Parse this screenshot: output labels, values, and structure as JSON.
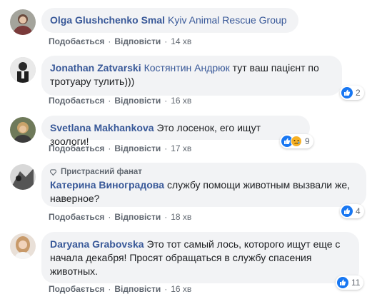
{
  "action_labels": {
    "like": "Подобається",
    "reply": "Відповісти",
    "separator": "·"
  },
  "comments": [
    {
      "author": "Olga Glushchenko Smal",
      "mention": "Kyiv Animal Rescue Group",
      "text": "",
      "time": "14 хв"
    },
    {
      "author": "Jonathan Zatvarski",
      "mention": "Костянтин Андрюк",
      "text": "тут ваш пацієнт по тротуару тулить)))",
      "time": "16 хв",
      "reaction_count": "2"
    },
    {
      "author": "Svetlana Makhankova",
      "mention": "",
      "text": "Это лосенок, его ищут зоологи!",
      "time": "17 хв",
      "reaction_count": "9"
    },
    {
      "badge": "Пристрасний фанат",
      "author": "Катерина Виноградова",
      "mention": "",
      "text": "службу помощи животным вызвали же, наверное?",
      "time": "18 хв",
      "reaction_count": "4"
    },
    {
      "author": "Daryana Grabovska",
      "mention": "",
      "text": "Это тот самый лось, которого ищут еще с начала декабря! Просят обращаться в службу спасения животных.",
      "time": "16 хв",
      "reaction_count": "11"
    }
  ],
  "colors": {
    "link_blue": "#385898",
    "bubble_bg": "#f2f3f5",
    "like_blue": "#1877f2",
    "sad_yellow": "#f7b125",
    "meta_gray": "#606770"
  }
}
